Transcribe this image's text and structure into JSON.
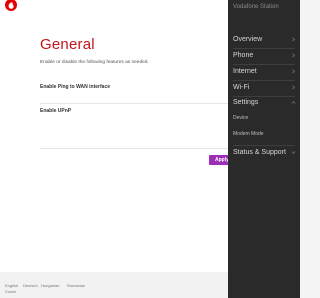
{
  "header": {
    "logo_icon": "vodafone-logo-icon",
    "brand_color": "#e60000"
  },
  "main": {
    "title": "General",
    "subtitle": "Enable or disable the following features as needed.",
    "settings": [
      {
        "label": "Enable Ping to WAN interface"
      },
      {
        "label": "Enable UPnP"
      }
    ],
    "apply_label": "Apply",
    "apply_color": "#9c2fb6"
  },
  "footer": {
    "languages": [
      "English",
      "Deutsch",
      "Hungarian",
      "Romanian",
      "Czech"
    ]
  },
  "sidemenu": {
    "title": "Vodafone Station",
    "items": [
      {
        "label": "Overview",
        "icon": "chevron-right-icon"
      },
      {
        "label": "Phone",
        "icon": "chevron-right-icon"
      },
      {
        "label": "Internet",
        "icon": "chevron-right-icon"
      },
      {
        "label": "Wi-Fi",
        "icon": "chevron-right-icon"
      },
      {
        "label": "Settings",
        "icon": "chevron-up-icon"
      }
    ],
    "subitems": [
      {
        "label": "Device"
      },
      {
        "label": "Modem Mode"
      }
    ],
    "support": {
      "label": "Status & Support",
      "icon": "chevron-down-icon"
    }
  }
}
